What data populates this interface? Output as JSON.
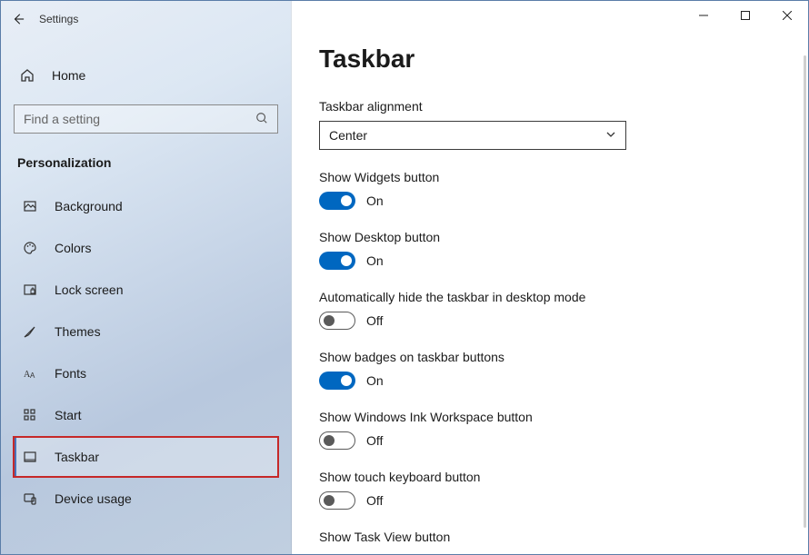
{
  "app": {
    "title": "Settings"
  },
  "sidebar": {
    "home_label": "Home",
    "search_placeholder": "Find a setting",
    "section": "Personalization",
    "items": [
      {
        "label": "Background"
      },
      {
        "label": "Colors"
      },
      {
        "label": "Lock screen"
      },
      {
        "label": "Themes"
      },
      {
        "label": "Fonts"
      },
      {
        "label": "Start"
      },
      {
        "label": "Taskbar"
      },
      {
        "label": "Device usage"
      }
    ]
  },
  "main": {
    "title": "Taskbar",
    "alignment_label": "Taskbar alignment",
    "alignment_value": "Center",
    "toggles": [
      {
        "label": "Show Widgets button",
        "state": "On",
        "on": true
      },
      {
        "label": "Show Desktop button",
        "state": "On",
        "on": true
      },
      {
        "label": "Automatically hide the taskbar in desktop mode",
        "state": "Off",
        "on": false
      },
      {
        "label": "Show badges on taskbar buttons",
        "state": "On",
        "on": true
      },
      {
        "label": "Show Windows Ink Workspace button",
        "state": "Off",
        "on": false
      },
      {
        "label": "Show touch keyboard button",
        "state": "Off",
        "on": false
      },
      {
        "label": "Show Task View button",
        "state": "",
        "on": true
      }
    ]
  }
}
